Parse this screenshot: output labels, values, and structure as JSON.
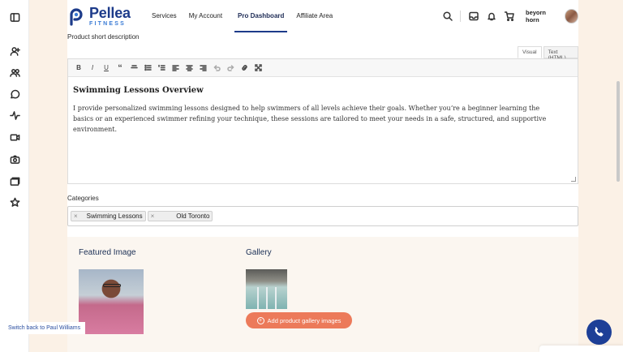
{
  "header": {
    "logo": {
      "name": "Pellea",
      "sub": "FITNESS"
    },
    "nav": [
      {
        "label": "Services"
      },
      {
        "label": "My Account"
      },
      {
        "label": "Pro Dashboard",
        "active": true
      },
      {
        "label": "Affiliate Area"
      }
    ],
    "user_name": "beyorn horn"
  },
  "form": {
    "short_desc_label": "Product short description",
    "editor_tabs": [
      "Visual",
      "Text (HTML)"
    ],
    "editor_heading": "Swimming Lessons Overview",
    "editor_body": "I provide personalized swimming lessons designed to help swimmers of all levels achieve their goals. Whether you’re a beginner learning the basics or an experienced swimmer refining your technique, these sessions are tailored to meet your needs in a safe, structured, and supportive environment.",
    "categories_label": "Categories",
    "categories": [
      "Swimming Lessons",
      "Old Toronto"
    ],
    "featured_image_label": "Featured Image",
    "gallery_label": "Gallery",
    "add_gallery_button": "Add product gallery images"
  },
  "footer": {
    "switch_back": "Switch back to Paul Williams"
  },
  "colors": {
    "brand": "#1d3b8a",
    "accent": "#ec7a5a",
    "background": "#fbf1e6"
  }
}
